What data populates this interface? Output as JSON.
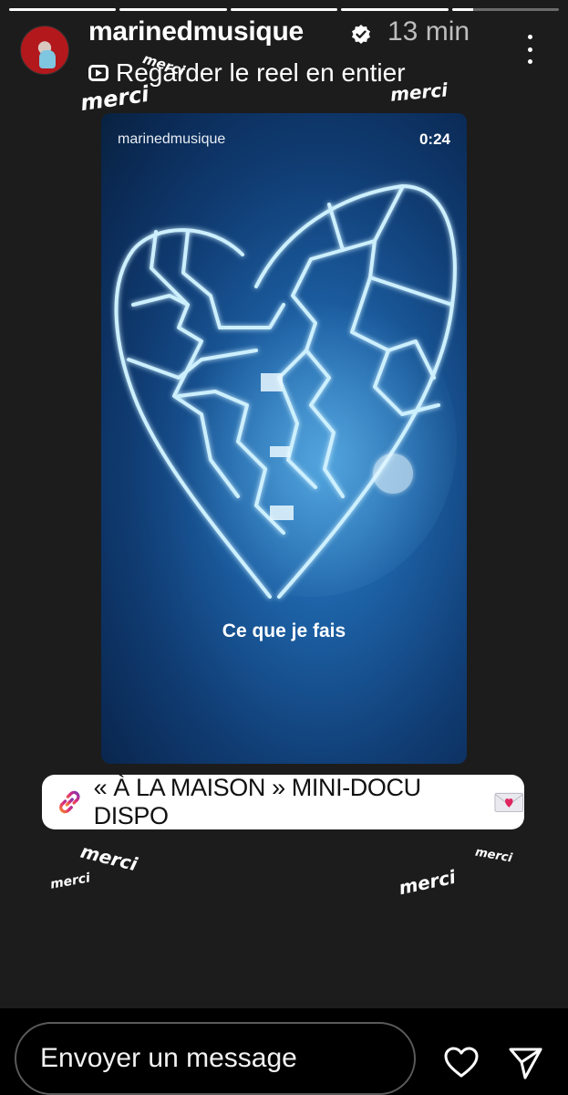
{
  "progress": [
    1,
    1,
    1,
    1,
    0.2
  ],
  "header": {
    "username": "marinedmusique",
    "time": "13 min",
    "reel_link_label": "Regarder le reel en entier"
  },
  "stickers": {
    "merci": "merci"
  },
  "reel": {
    "username": "marinedmusique",
    "duration": "0:24",
    "caption": "Ce que je fais"
  },
  "link_sticker": {
    "label": "« À LA MAISON » MINI-DOCU DISPO"
  },
  "message": {
    "placeholder": "Envoyer un message"
  },
  "colors": {
    "background": "#1c1c1c",
    "reel_blue": "#1c5fa3",
    "link_bg": "#ffffff"
  },
  "icons": [
    "link-icon",
    "love-letter-icon",
    "verified-badge-icon",
    "more-icon",
    "reel-play-icon",
    "heart-icon",
    "send-icon"
  ]
}
